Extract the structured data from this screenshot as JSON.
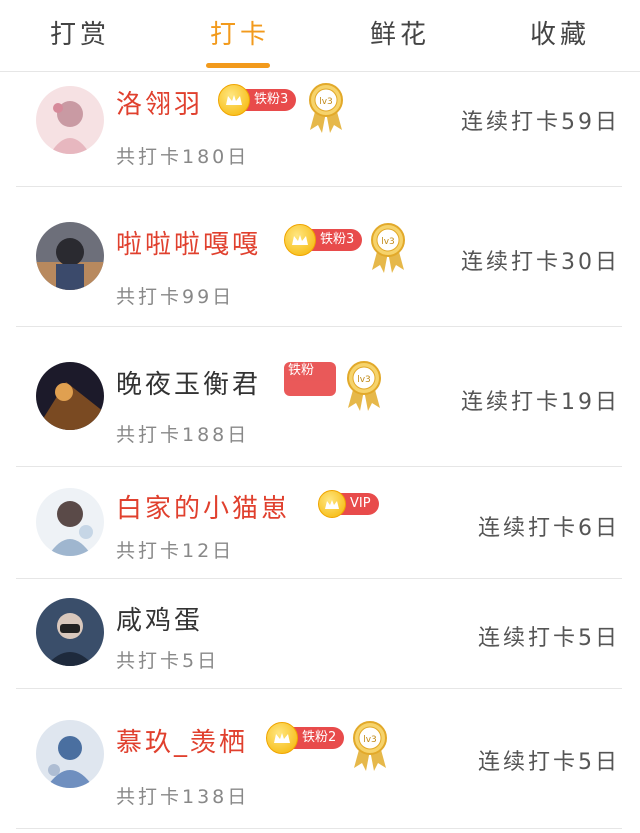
{
  "tabs": [
    {
      "label": "打赏",
      "active": false
    },
    {
      "label": "打卡",
      "active": true
    },
    {
      "label": "鲜花",
      "active": false
    },
    {
      "label": "收藏",
      "active": false
    }
  ],
  "accent_color": "#f29a1c",
  "name_red_color": "#e0402e",
  "rows": [
    {
      "name": "洛翎羽",
      "badge": "铁粉3",
      "medal": "lv3",
      "total": "共打卡180日",
      "streak": "连续打卡59日"
    },
    {
      "name": "啦啦啦嘎嘎",
      "badge": "铁粉3",
      "medal": "lv3",
      "total": "共打卡99日",
      "streak": "连续打卡30日"
    },
    {
      "name": "晚夜玉衡君",
      "badge": "铁粉",
      "medal": "lv3",
      "total": "共打卡188日",
      "streak": "连续打卡19日"
    },
    {
      "name": "白家的小猫崽",
      "badge": "VIP",
      "total": "共打卡12日",
      "streak": "连续打卡6日"
    },
    {
      "name": "咸鸡蛋",
      "total": "共打卡5日",
      "streak": "连续打卡5日"
    },
    {
      "name": "慕玖_羡栖",
      "badge": "铁粉2",
      "medal": "lv3",
      "total": "共打卡138日",
      "streak": "连续打卡5日"
    }
  ]
}
